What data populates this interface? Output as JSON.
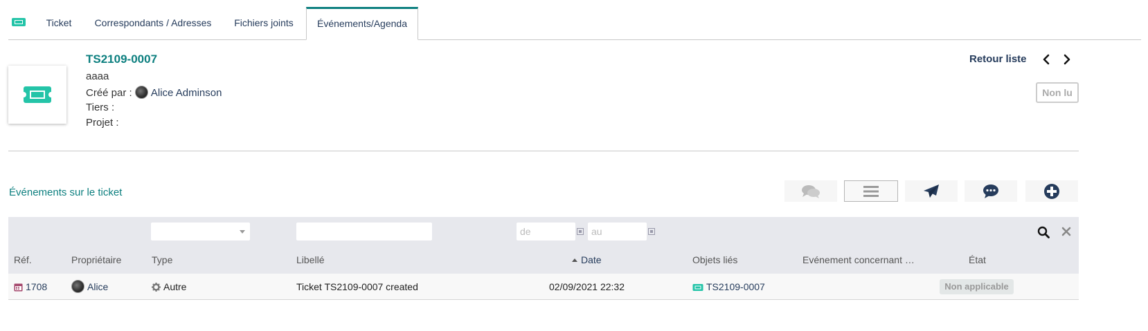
{
  "tabs": {
    "items": [
      "Ticket",
      "Correspondants / Adresses",
      "Fichiers joints",
      "Événements/Agenda"
    ],
    "active": "Événements/Agenda"
  },
  "ticket": {
    "ref": "TS2109-0007",
    "subject": "aaaa",
    "created_by_label": "Créé par :",
    "created_by_user": "Alice Adminson",
    "tiers_label": "Tiers :",
    "project_label": "Projet :",
    "back_to_list": "Retour liste",
    "status_button": "Non lu"
  },
  "events": {
    "title": "Événements sur le ticket",
    "filters": {
      "date_from_placeholder": "de",
      "date_to_placeholder": "au"
    },
    "columns": [
      "Réf.",
      "Propriétaire",
      "Type",
      "Libellé",
      "Date",
      "Objets liés",
      "Evénement concernant …",
      "État"
    ],
    "rows": [
      {
        "ref": "1708",
        "owner": "Alice",
        "type": "Autre",
        "label": "Ticket TS2109-0007 created",
        "date": "02/09/2021 22:32",
        "linked": "TS2109-0007",
        "concerning": "",
        "state": "Non applicable"
      }
    ]
  },
  "icons": {
    "ticket": "ticket-icon",
    "prev": "chevron-left-icon",
    "next": "chevron-right-icon",
    "comments": "comments-icon",
    "list": "list-icon",
    "send": "paper-plane-icon",
    "chat": "chat-bubble-icon",
    "add": "plus-circle-icon",
    "search": "search-icon",
    "clear": "close-icon",
    "calendar": "calendar-icon",
    "gear": "gear-icon"
  },
  "colors": {
    "accent": "#0c7f7f",
    "ticket_icon": "#24c4a8",
    "link": "#263c5c",
    "calendar_icon": "#a3456a"
  }
}
